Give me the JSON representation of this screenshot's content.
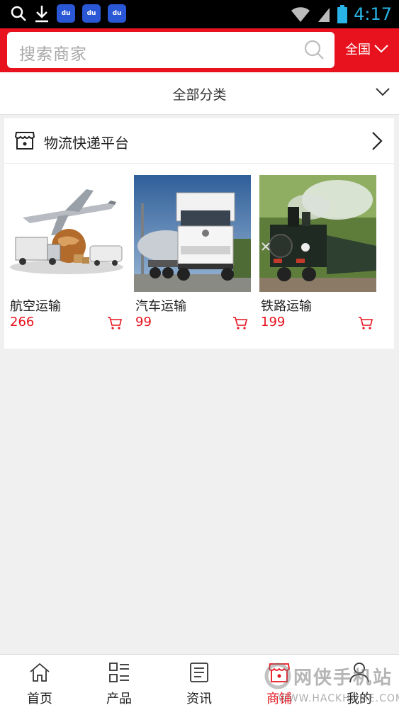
{
  "status_bar": {
    "time": "4:17",
    "baidu_icon_text": "du"
  },
  "search": {
    "placeholder": "搜索商家",
    "region": "全国"
  },
  "category": {
    "title": "全部分类"
  },
  "shop": {
    "title": "物流快递平台",
    "products": [
      {
        "name": "航空运输",
        "price": "266"
      },
      {
        "name": "汽车运输",
        "price": "99"
      },
      {
        "name": "铁路运输",
        "price": "199"
      }
    ]
  },
  "bottom_nav": {
    "items": [
      {
        "label": "首页",
        "icon": "home-icon"
      },
      {
        "label": "产品",
        "icon": "grid-list-icon"
      },
      {
        "label": "资讯",
        "icon": "news-icon"
      },
      {
        "label": "商铺",
        "icon": "shop-icon"
      },
      {
        "label": "我的",
        "icon": "user-icon"
      }
    ],
    "active_index": 3
  },
  "watermark": {
    "text": "网侠手机站",
    "url": "WWW.HACKHOME.COM"
  },
  "colors": {
    "brand_red": "#e7121d",
    "status_time": "#28b4e6"
  }
}
